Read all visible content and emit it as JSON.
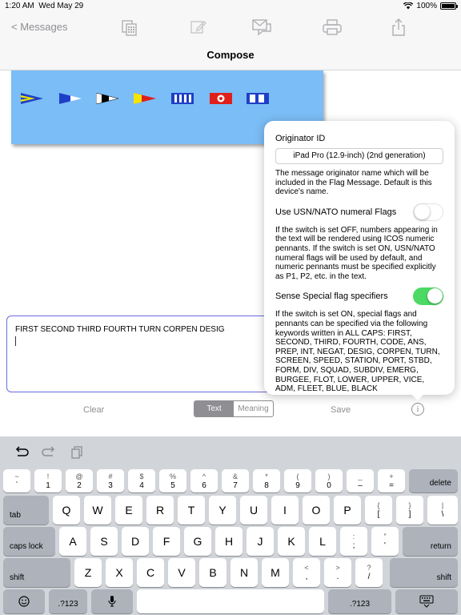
{
  "status_bar": {
    "time": "1:20 AM",
    "date": "Wed May 29",
    "battery": "100%"
  },
  "nav": {
    "back_label": "< Messages",
    "title": "Compose",
    "icons": [
      "flag-grid-icon",
      "edit-icon",
      "envelope-icon",
      "print-icon",
      "share-icon"
    ]
  },
  "colors": {
    "banner": "#7bbdf6",
    "accent": "#4cd964",
    "text_border": "#6a6adf",
    "muted": "#8e8e93"
  },
  "flags": [
    "first-substitute-pennant-icon",
    "second-substitute-pennant-icon",
    "third-substitute-pennant-icon",
    "fourth-substitute-pennant-icon",
    "turn-flag-icon",
    "corpen-flag-icon",
    "desig-flag-icon"
  ],
  "message": {
    "text": "FIRST SECOND THIRD FOURTH TURN CORPEN DESIG"
  },
  "controls": {
    "clear_label": "Clear",
    "segments": [
      {
        "label": "Text",
        "selected": true
      },
      {
        "label": "Meaning",
        "selected": false
      }
    ],
    "save_label": "Save",
    "info_label": "i"
  },
  "popover": {
    "originator_label": "Originator ID",
    "originator_value": "iPad Pro (12.9-inch) (2nd generation)",
    "originator_desc": "The message originator name which will be included in the Flag Message.  Default is this device's name.",
    "usn_label": "Use USN/NATO numeral Flags",
    "usn_on": false,
    "usn_desc": "If the switch is set OFF, numbers appearing in the text will be rendered using ICOS numeric pennants.  If the switch is set ON, USN/NATO numeral flags will be used by default, and numeric pennants must be specified explicitly as P1, P2, etc. in the text.",
    "special_label": "Sense Special flag specifiers",
    "special_on": true,
    "special_desc": "If the switch is set ON, special flags and pennants can be specified via the following keywords written in ALL CAPS: FIRST, SECOND, THIRD, FOURTH, CODE, ANS, PREP, INT, NEGAT, DESIG, CORPEN, TURN, SCREEN, SPEED, STATION, PORT, STBD, FORM, DIV, SQUAD, SUBDIV, EMERG, BURGEE, FLOT, LOWER, UPPER, VICE, ADM, FLEET, BLUE, BLACK"
  },
  "keyboard": {
    "toolbar": [
      "undo-icon",
      "redo-icon",
      "clipboard-icon"
    ],
    "row1": [
      {
        "top": "~",
        "bottom": "`"
      },
      {
        "top": "!",
        "bottom": "1"
      },
      {
        "top": "@",
        "bottom": "2"
      },
      {
        "top": "#",
        "bottom": "3"
      },
      {
        "top": "$",
        "bottom": "4"
      },
      {
        "top": "%",
        "bottom": "5"
      },
      {
        "top": "^",
        "bottom": "6"
      },
      {
        "top": "&",
        "bottom": "7"
      },
      {
        "top": "*",
        "bottom": "8"
      },
      {
        "top": "(",
        "bottom": "9"
      },
      {
        "top": ")",
        "bottom": "0"
      },
      {
        "top": "_",
        "bottom": "–"
      },
      {
        "top": "+",
        "bottom": "="
      }
    ],
    "delete": "delete",
    "tab": "tab",
    "row2": [
      "Q",
      "W",
      "E",
      "R",
      "T",
      "Y",
      "U",
      "I",
      "O",
      "P"
    ],
    "row2_sym": [
      {
        "top": "{",
        "bottom": "["
      },
      {
        "top": "}",
        "bottom": "]"
      },
      {
        "top": "|",
        "bottom": "\\"
      }
    ],
    "caps": "caps lock",
    "row3": [
      "A",
      "S",
      "D",
      "F",
      "G",
      "H",
      "J",
      "K",
      "L"
    ],
    "row3_sym": [
      {
        "top": ":",
        "bottom": ";"
      },
      {
        "top": "”",
        "bottom": "'"
      }
    ],
    "return": "return",
    "shift": "shift",
    "row4": [
      "Z",
      "X",
      "C",
      "V",
      "B",
      "N",
      "M"
    ],
    "row4_sym": [
      {
        "top": "<",
        "bottom": ","
      },
      {
        "top": ">",
        "bottom": "."
      },
      {
        "top": "?",
        "bottom": "/"
      }
    ],
    "num_label": ".?123",
    "bottom_icons": [
      "emoji-icon",
      "microphone-icon",
      "keyboard-dismiss-icon"
    ]
  }
}
